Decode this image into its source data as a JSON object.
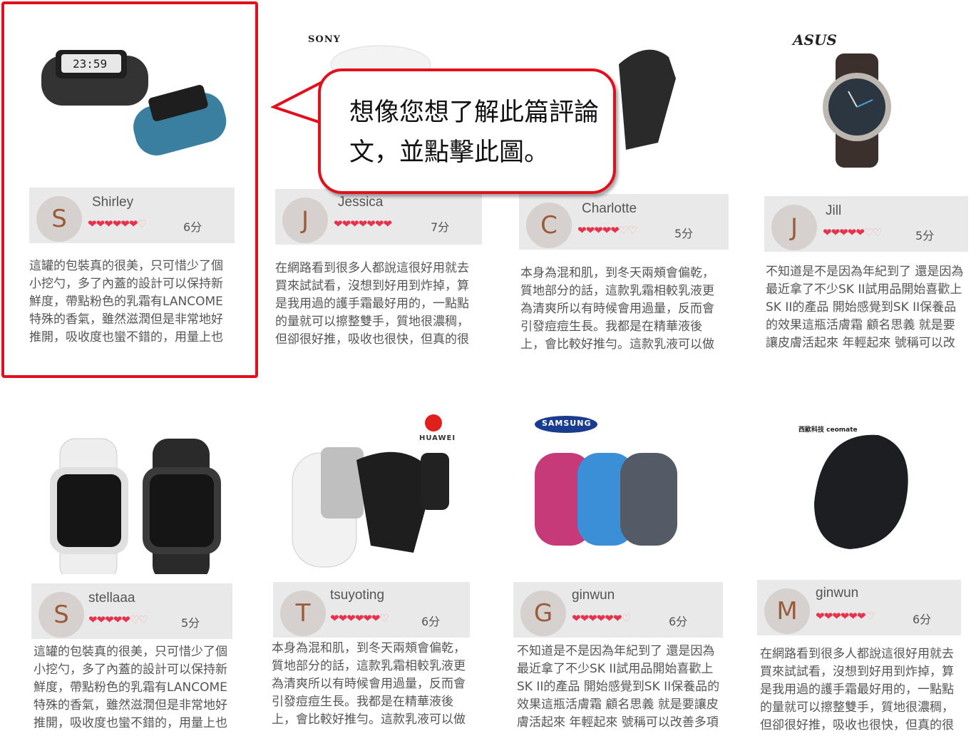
{
  "callout": {
    "text": "想像您想了解此篇評論文，並點擊此圖。"
  },
  "colors": {
    "highlight": "#e0101d",
    "hearts": "#e8314b"
  },
  "cards": [
    {
      "brand": "",
      "product_icon": "black-blue-fitness-band-pair",
      "avatar": "S",
      "name": "Shirley",
      "rating": 6,
      "score": "6分",
      "review": "這罐的包裝真的很美，只可惜少了個小挖勺，多了內蓋的設計可以保持新鮮度，帶點粉色的乳霜有LANCOME特殊的香氣，雖然滋潤但是非常地好推開，吸收度也蠻不錯的，用量上也很省，用一點就可以"
    },
    {
      "brand": "SONY",
      "product_icon": "sony-white-band",
      "avatar": "J",
      "name": "Jessica",
      "rating": 7,
      "score": "7分",
      "review": "在網路看到很多人都說這很好用就去買來試試看，沒想到好用到炸掉，算是我用過的護手霜最好用的，一點點的量就可以擦整雙手，質地很濃稠，但卻很好推，吸收也很快，但真的很像小孩子的味道"
    },
    {
      "brand": "",
      "product_icon": "black-band",
      "avatar": "C",
      "name": "Charlotte",
      "rating": 5,
      "score": "5分",
      "review": "本身為混和肌，到冬天兩頰會偏乾，質地部分的話，這款乳霜相較乳液更為清爽所以有時候會用過量，反而會引發痘痘生長。我都是在精華液後上，會比較好推勻。這款乳液可以做到保濕的工作，日不"
    },
    {
      "brand": "ASUS",
      "product_icon": "asus-zenwatch",
      "avatar": "J",
      "name": "Jill",
      "rating": 5,
      "score": "5分",
      "review": "不知道是不是因為年紀到了 還是因為最近拿了不少SK II試用品開始喜歡上SK II的產品 開始感覺到SK II保養品的效果這瓶活膚霜 顧名思義 就是要讓皮膚活起來 年輕起來 號稱可以改善多項肌膚問題 真的很符合現"
    },
    {
      "brand": "",
      "product_icon": "white-black-smartwatch-pair",
      "avatar": "S",
      "name": "stellaaa",
      "rating": 5,
      "score": "5分",
      "review": "這罐的包裝真的很美，只可惜少了個小挖勺，多了內蓋的設計可以保持新鮮度，帶點粉色的乳霜有LANCOME特殊的香氣，雖然滋潤但是非常地好推開，吸收度也蠻不錯的，用量上也很省，用一點就可以"
    },
    {
      "brand": "HUAWEI",
      "product_icon": "huawei-talkband-with-earpiece",
      "avatar": "T",
      "name": "tsuyoting",
      "rating": 6,
      "score": "6分",
      "review": "本身為混和肌，到冬天兩頰會偏乾，質地部分的話，這款乳霜相較乳液更為清爽所以有時候會用過量，反而會引發痘痘生長。我都是在精華液後上，會比較好推勻。這款乳液可以做到保濕的工作，日不"
    },
    {
      "brand": "SAMSUNG",
      "product_icon": "samsung-gear-fit-trio",
      "avatar": "G",
      "name": "ginwun",
      "rating": 6,
      "score": "6分",
      "review": "不知道是不是因為年紀到了 還是因為最近拿了不少SK II試用品開始喜歡上SK II的產品 開始感覺到SK II保養品的效果這瓶活膚霜 顧名思義 就是要讓皮膚活起來 年輕起來 號稱可以改善多項肌膚問題 真的很符合現"
    },
    {
      "brand": "西歐科技 ceomate",
      "product_icon": "black-curved-band",
      "avatar": "M",
      "name": "ginwun",
      "rating": 6,
      "score": "6分",
      "review": "在網路看到很多人都說這很好用就去買來試試看，沒想到好用到炸掉，算是我用過的護手霜最好用的，一點點的量就可以擦整雙手，質地很濃稠，但卻很好推，吸收也很快，但真的很像小孩子的味道"
    }
  ]
}
